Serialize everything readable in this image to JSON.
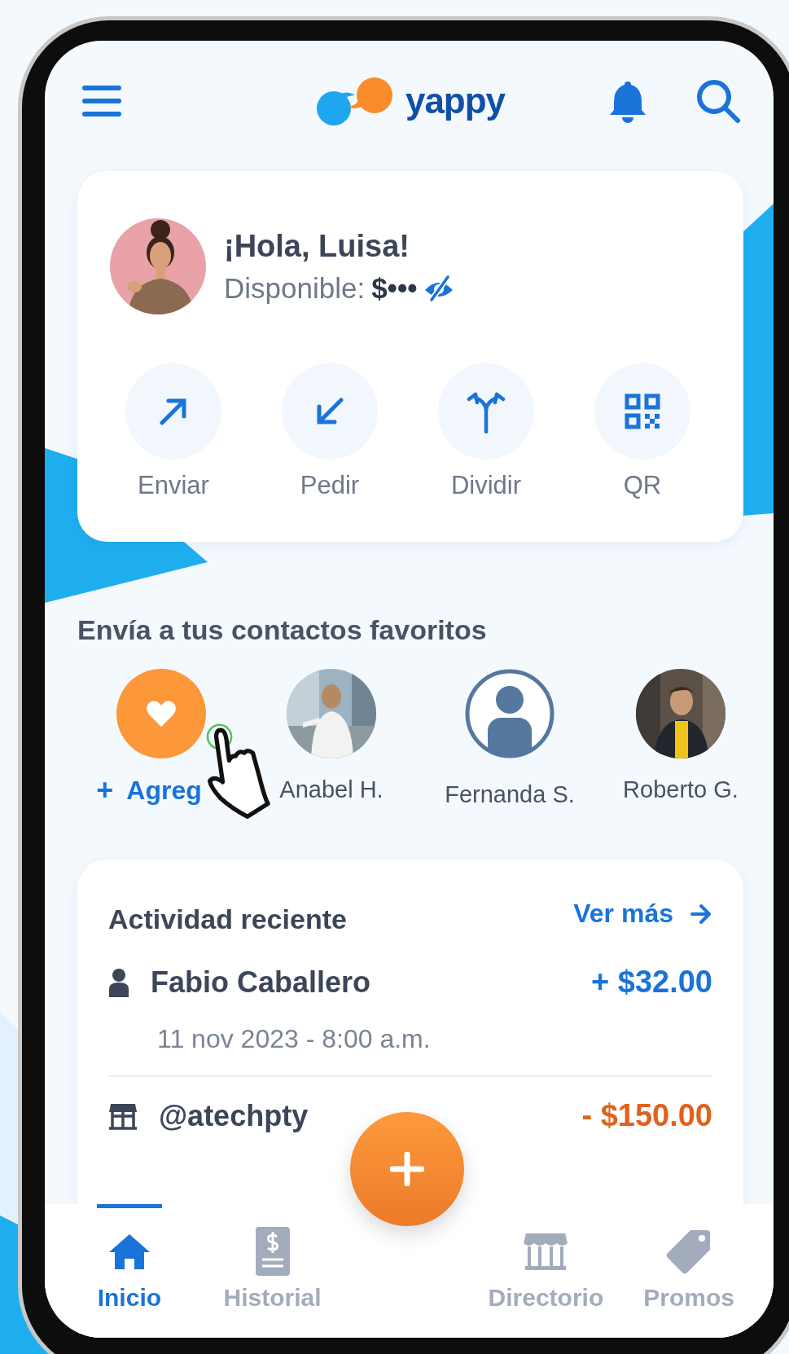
{
  "header": {
    "logo": "yappy"
  },
  "greeting": {
    "title": "¡Hola, Luisa!",
    "balance_label": "Disponible:",
    "balance": "$•••",
    "balance_hidden": true
  },
  "actions": [
    {
      "label": "Enviar",
      "kind": "send"
    },
    {
      "label": "Pedir",
      "kind": "request"
    },
    {
      "label": "Dividir",
      "kind": "split"
    },
    {
      "label": "QR",
      "kind": "qr"
    }
  ],
  "favorites": {
    "title": "Envía a tus contactos favoritos",
    "contacts": [
      {
        "name": "Agreg",
        "kind": "add",
        "prefix": "+"
      },
      {
        "name": "Anabel H."
      },
      {
        "name": "Fernanda S.",
        "kind": "placeholder"
      },
      {
        "name": "Roberto G."
      }
    ]
  },
  "activity": {
    "title": "Actividad reciente",
    "link": "Ver más",
    "items": [
      {
        "name": "Fabio Caballero",
        "kind": "person",
        "amount": "+ $32.00",
        "color": "#1a73d9",
        "date": "11 nov 2023 - 8:00 a.m."
      },
      {
        "name": "@atechpty",
        "kind": "store",
        "amount": "- $150.00",
        "color": "#e0621b"
      }
    ]
  },
  "nav": [
    {
      "label": "Inicio",
      "kind": "home",
      "selected": true
    },
    {
      "label": "Historial",
      "kind": "history",
      "selected": false
    },
    {
      "label": "Directorio",
      "kind": "directory",
      "selected": false
    },
    {
      "label": "Promos",
      "kind": "promos",
      "selected": false
    }
  ]
}
